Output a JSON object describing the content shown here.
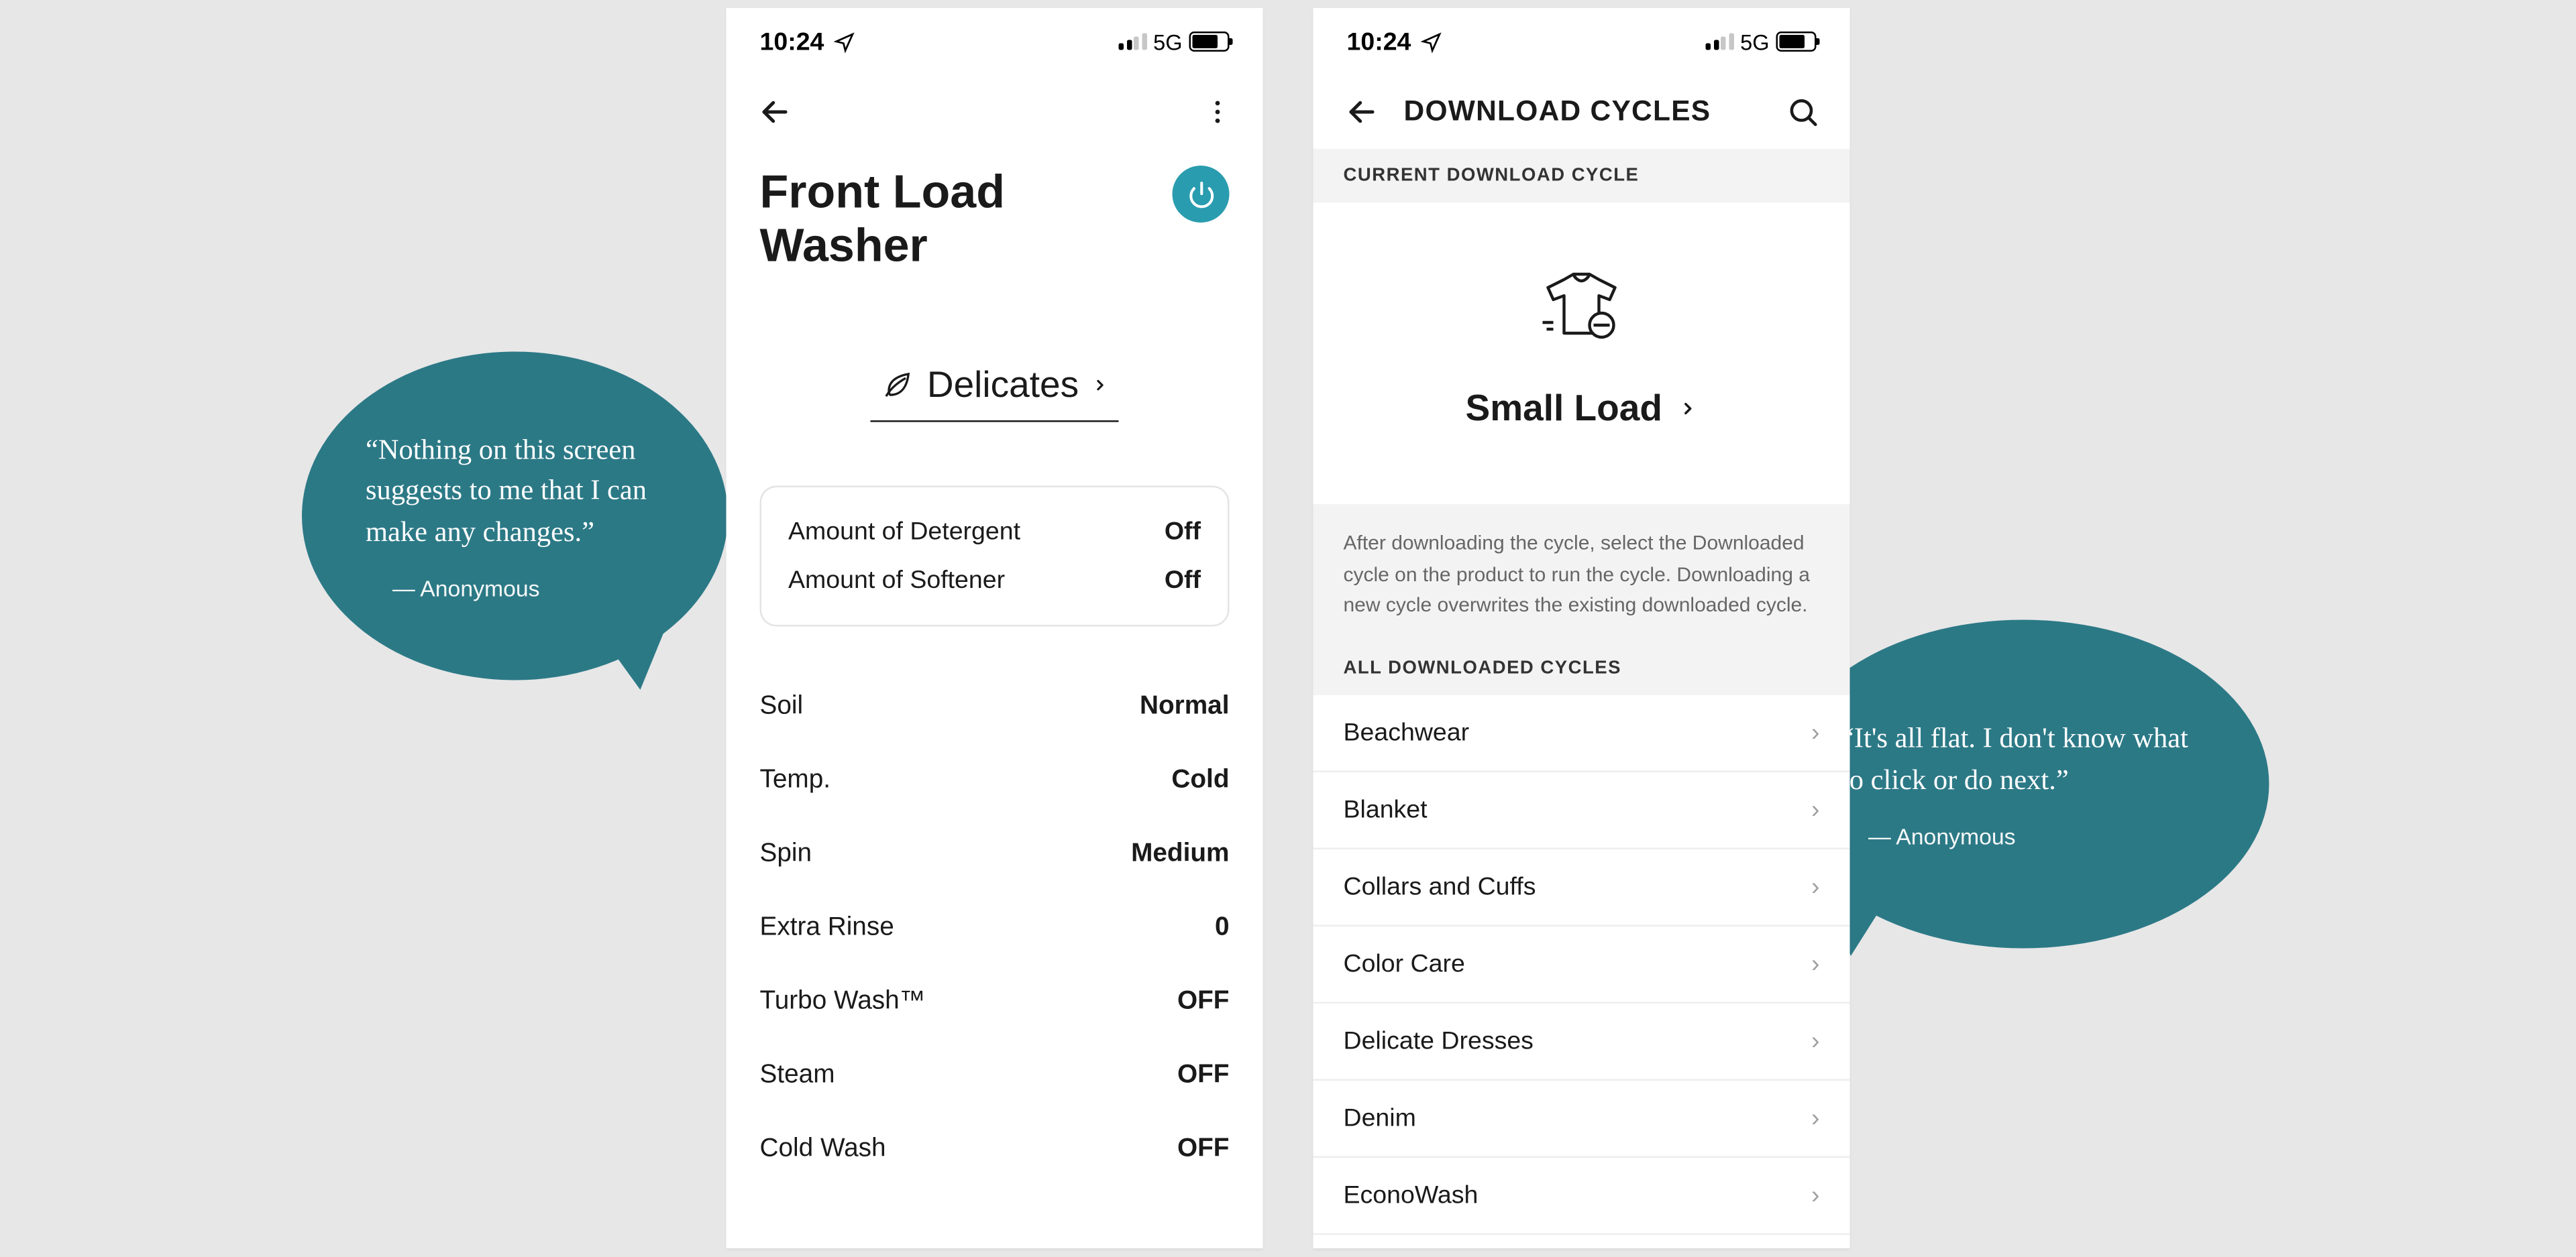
{
  "statusbar": {
    "time": "10:24",
    "network": "5G"
  },
  "phone1": {
    "title": "Front Load Washer",
    "cycle_label": "Delicates",
    "dispenser": [
      {
        "label": "Amount of Detergent",
        "value": "Off"
      },
      {
        "label": "Amount of Softener",
        "value": "Off"
      }
    ],
    "settings": [
      {
        "label": "Soil",
        "value": "Normal"
      },
      {
        "label": "Temp.",
        "value": "Cold"
      },
      {
        "label": "Spin",
        "value": "Medium"
      },
      {
        "label": "Extra Rinse",
        "value": "0"
      },
      {
        "label": "Turbo Wash™",
        "value": "OFF"
      },
      {
        "label": "Steam",
        "value": "OFF"
      },
      {
        "label": "Cold Wash",
        "value": "OFF"
      }
    ]
  },
  "phone2": {
    "nav_title": "DOWNLOAD CYCLES",
    "section_current": "CURRENT DOWNLOAD CYCLE",
    "current_cycle": "Small Load",
    "helper_text": "After downloading the cycle, select the Downloaded cycle on the product to run the cycle. Downloading a new cycle overwrites the existing downloaded cycle.",
    "section_all": "ALL DOWNLOADED CYCLES",
    "cycles": [
      "Beachwear",
      "Blanket",
      "Collars and Cuffs",
      "Color Care",
      "Delicate Dresses",
      "Denim",
      "EconoWash"
    ]
  },
  "callouts": {
    "c1": {
      "quote": "“Nothing on this screen suggests to me that I can make any changes.”",
      "attrib": "— Anonymous"
    },
    "c2": {
      "quote": "“It's all flat. I don't know what to click or do next.”",
      "attrib": "— Anonymous"
    }
  }
}
